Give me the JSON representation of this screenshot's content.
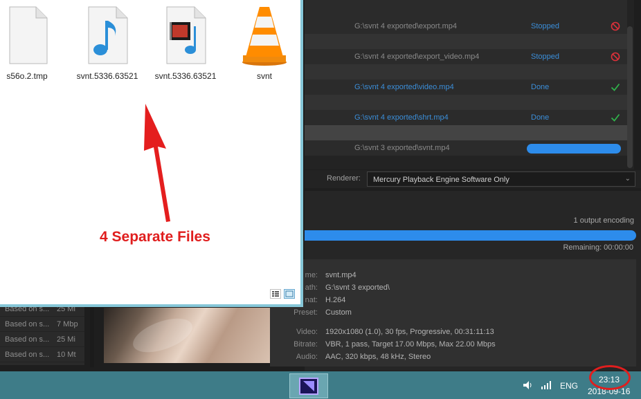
{
  "explorer": {
    "files": [
      {
        "name": "s56o.2.tmp",
        "icon": "blank-file-icon"
      },
      {
        "name": "svnt.5336.63521",
        "icon": "audio-file-icon"
      },
      {
        "name": "svnt.5336.63521",
        "icon": "video-file-icon"
      },
      {
        "name": "svnt",
        "icon": "vlc-cone-icon"
      }
    ]
  },
  "annotation": {
    "text": "4 Separate Files",
    "color": "#e01e1e"
  },
  "queue": {
    "rows": [
      {
        "path": "G:\\svnt 4 exported\\export.mp4",
        "status": "Stopped",
        "icon": "stop-icon"
      },
      {
        "path": "G:\\svnt 4 exported\\export_video.mp4",
        "status": "Stopped",
        "icon": "stop-icon"
      },
      {
        "path": "G:\\svnt 4 exported\\video.mp4",
        "status": "Done",
        "icon": "check-icon"
      },
      {
        "path": "G:\\svnt 4 exported\\shrt.mp4",
        "status": "Done",
        "icon": "check-icon"
      },
      {
        "path": "G:\\svnt 3 exported\\svnt.mp4",
        "status": "",
        "icon": "progress-bar"
      }
    ]
  },
  "renderer": {
    "label": "Renderer:",
    "value": "Mercury Playback Engine Software Only"
  },
  "encoding": {
    "status": "1 output encoding",
    "remaining": "Remaining: 00:00:00",
    "progress": 1.0
  },
  "details": [
    {
      "label": "me:",
      "value": "svnt.mp4"
    },
    {
      "label": "ath:",
      "value": "G:\\svnt 3 exported\\"
    },
    {
      "label": "nat:",
      "value": "H.264"
    },
    {
      "label": "Preset:",
      "value": "Custom"
    },
    {
      "label": "Video:",
      "value": "1920x1080 (1.0), 30 fps, Progressive, 00:31:11:13"
    },
    {
      "label": "Bitrate:",
      "value": "VBR, 1 pass, Target 17.00 Mbps, Max 22.00 Mbps"
    },
    {
      "label": "Audio:",
      "value": "AAC, 320 kbps, 48 kHz, Stereo"
    }
  ],
  "side_list": [
    {
      "a": "Based on s...",
      "b": "25 Mi"
    },
    {
      "a": "Based on s...",
      "b": "7 Mbp"
    },
    {
      "a": "Based on s...",
      "b": "25 Mi"
    },
    {
      "a": "Based on s...",
      "b": "10 Mt"
    }
  ],
  "taskbar": {
    "lang": "ENG",
    "time": "23:13",
    "date": "2018-09-16"
  },
  "colors": {
    "accent": "#2d8ceb",
    "done": "#2fb24a",
    "stop": "#e0303a",
    "taskbar": "#3e7c88"
  }
}
